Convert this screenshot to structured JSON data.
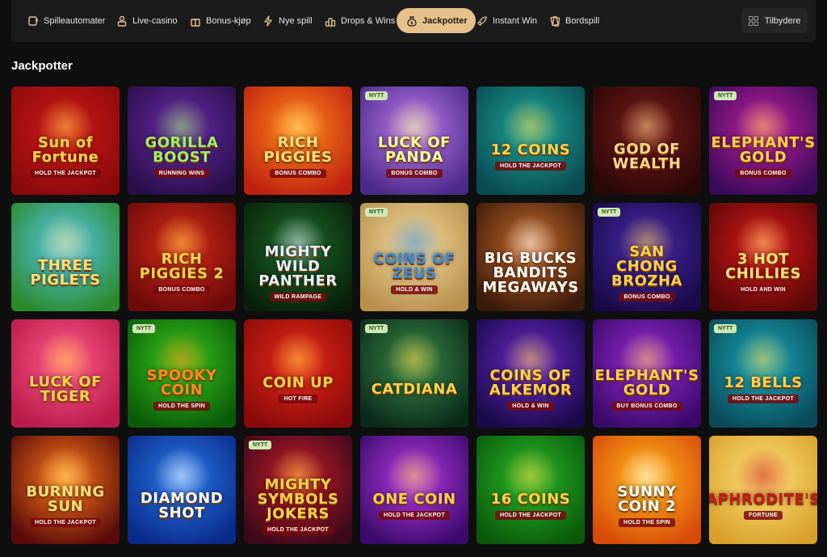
{
  "nav": {
    "items": [
      {
        "label": "Spilleautomater",
        "icon": "slot-machine-icon"
      },
      {
        "label": "Live-casino",
        "icon": "dealer-icon"
      },
      {
        "label": "Bonus-kjøp",
        "icon": "gift-icon"
      },
      {
        "label": "Nye spill",
        "icon": "lightning-icon"
      },
      {
        "label": "Drops & Wins",
        "icon": "trophy-icon"
      },
      {
        "label": "Jackpotter",
        "icon": "money-bag-icon",
        "active": true
      },
      {
        "label": "Instant Win",
        "icon": "rocket-icon"
      },
      {
        "label": "Bordspill",
        "icon": "cards-icon"
      }
    ],
    "providers_label": "Tilbydere"
  },
  "section_title": "Jackpotter",
  "badge_new": "NYTT",
  "games": [
    {
      "title": "Sun of Fortune",
      "subtitle": "HOLD THE JACKPOT",
      "new": false,
      "bg": [
        "#d01818",
        "#8a0a0a"
      ],
      "fg": "#ffd24a"
    },
    {
      "title": "GORILLA BOOST",
      "subtitle": "RUNNING WINS",
      "new": false,
      "bg": [
        "#6a2aa8",
        "#2a0f4a"
      ],
      "fg": "#9ef06a"
    },
    {
      "title": "RICH PIGGIES",
      "subtitle": "BONUS COMBO",
      "new": false,
      "bg": [
        "#ff8a1a",
        "#c02010"
      ],
      "fg": "#ffe07a"
    },
    {
      "title": "LUCK OF PANDA",
      "subtitle": "BONUS COMBO",
      "new": true,
      "bg": [
        "#c07ae8",
        "#4a2a8a"
      ],
      "fg": "#f8ff9a"
    },
    {
      "title": "12 COINS",
      "subtitle": "HOLD THE JACKPOT",
      "new": false,
      "bg": [
        "#1fa89a",
        "#0a4a52"
      ],
      "fg": "#ffd24a"
    },
    {
      "title": "GOD OF WEALTH",
      "subtitle": "",
      "new": false,
      "bg": [
        "#7a1a1a",
        "#2a0808"
      ],
      "fg": "#ffd88a"
    },
    {
      "title": "ELEPHANT'S GOLD",
      "subtitle": "BONUS COMBO",
      "new": true,
      "bg": [
        "#c020a0",
        "#3a0a5a"
      ],
      "fg": "#ffd24a"
    },
    {
      "title": "THREE PIGLETS",
      "subtitle": "",
      "new": false,
      "bg": [
        "#5ac8f0",
        "#2a8a2a"
      ],
      "fg": "#ffe07a"
    },
    {
      "title": "RICH PIGGIES 2",
      "subtitle": "BONUS COMBO",
      "new": false,
      "bg": [
        "#d82a18",
        "#6a0a0a"
      ],
      "fg": "#ffd24a"
    },
    {
      "title": "MIGHTY WILD PANTHER",
      "subtitle": "WILD RAMPAGE",
      "new": false,
      "bg": [
        "#1a6a2a",
        "#0a200a"
      ],
      "fg": "#e8f0ff"
    },
    {
      "title": "COINS OF ZEUS",
      "subtitle": "HOLD & WIN",
      "new": true,
      "bg": [
        "#f0d8a0",
        "#b8904a"
      ],
      "fg": "#3a8ad8"
    },
    {
      "title": "BIG BUCKS BANDITS MEGAWAYS",
      "subtitle": "",
      "new": false,
      "bg": [
        "#c86a2a",
        "#3a1a0a"
      ],
      "fg": "#ffffff"
    },
    {
      "title": "SAN CHONG BROZHA",
      "subtitle": "BONUS COMBO",
      "new": true,
      "bg": [
        "#4a2aa8",
        "#1a0a4a"
      ],
      "fg": "#ffd24a"
    },
    {
      "title": "3 HOT CHILLIES",
      "subtitle": "HOLD AND WIN",
      "new": false,
      "bg": [
        "#d81818",
        "#5a0808"
      ],
      "fg": "#ffe07a"
    },
    {
      "title": "LUCK OF TIGER",
      "subtitle": "",
      "new": false,
      "bg": [
        "#ff5a8a",
        "#b81a4a"
      ],
      "fg": "#ffd24a"
    },
    {
      "title": "SPOOKY COIN",
      "subtitle": "HOLD THE SPIN",
      "new": true,
      "bg": [
        "#3ac81a",
        "#0a5a0a"
      ],
      "fg": "#ff8a1a"
    },
    {
      "title": "COIN UP",
      "subtitle": "HOT FIRE",
      "new": false,
      "bg": [
        "#e82a18",
        "#8a0a0a"
      ],
      "fg": "#ffd24a"
    },
    {
      "title": "CATDIANA",
      "subtitle": "",
      "new": true,
      "bg": [
        "#3a8a4a",
        "#0a2a1a"
      ],
      "fg": "#ffd24a"
    },
    {
      "title": "COINS OF ALKEMOR",
      "subtitle": "HOLD & WIN",
      "new": false,
      "bg": [
        "#6a2ac8",
        "#1a0a4a"
      ],
      "fg": "#ffd24a"
    },
    {
      "title": "ELEPHANT'S GOLD",
      "subtitle": "BUY BONUS COMBO",
      "new": false,
      "bg": [
        "#9a2ad8",
        "#3a0a6a"
      ],
      "fg": "#ffd24a"
    },
    {
      "title": "12 BELLS",
      "subtitle": "HOLD THE JACKPOT",
      "new": true,
      "bg": [
        "#1aa8b8",
        "#0a4a5a"
      ],
      "fg": "#ffd24a"
    },
    {
      "title": "BURNING SUN",
      "subtitle": "HOLD THE JACKPOT",
      "new": false,
      "bg": [
        "#ff7a1a",
        "#5a0a0a"
      ],
      "fg": "#ffe07a"
    },
    {
      "title": "DIAMOND SHOT",
      "subtitle": "",
      "new": false,
      "bg": [
        "#2a7ae8",
        "#0a2a8a"
      ],
      "fg": "#ffffff"
    },
    {
      "title": "MIGHTY SYMBOLS JOKERS",
      "subtitle": "HOLD THE JACKPOT",
      "new": true,
      "bg": [
        "#c81a2a",
        "#3a0a1a"
      ],
      "fg": "#ffd24a"
    },
    {
      "title": "ONE COIN",
      "subtitle": "HOLD THE JACKPOT",
      "new": false,
      "bg": [
        "#b83ae8",
        "#3a0a6a"
      ],
      "fg": "#ffd24a"
    },
    {
      "title": "16 COINS",
      "subtitle": "HOLD THE JACKPOT",
      "new": false,
      "bg": [
        "#2ab82a",
        "#0a5a0a"
      ],
      "fg": "#ffd24a"
    },
    {
      "title": "SUNNY COIN 2",
      "subtitle": "HOLD THE SPIN",
      "new": false,
      "bg": [
        "#ffb81a",
        "#d84a0a"
      ],
      "fg": "#ffffff"
    },
    {
      "title": "APHRODITE'S",
      "subtitle": "FORTUNE",
      "new": false,
      "bg": [
        "#ffe07a",
        "#d8a02a"
      ],
      "fg": "#c81a1a"
    }
  ],
  "colors": {
    "accent": "#e6c28a",
    "background": "#0f0f0f",
    "nav_bg": "#1b1b1b"
  }
}
